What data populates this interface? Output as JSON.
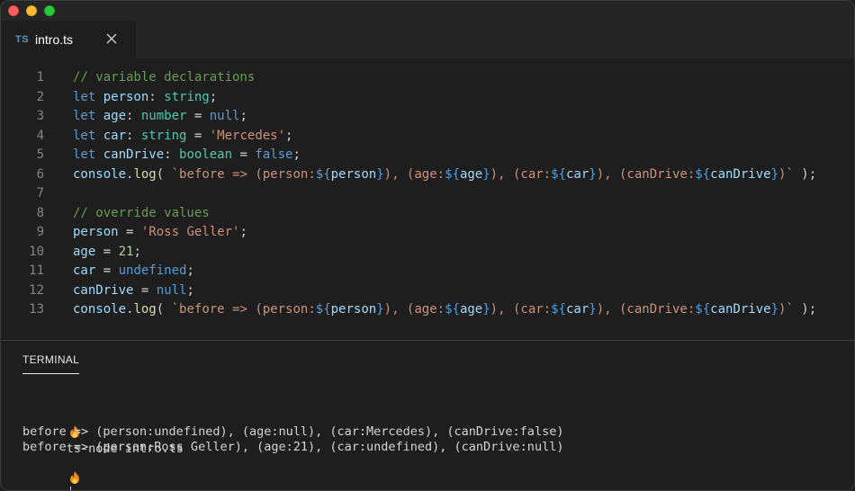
{
  "tab": {
    "lang": "TS",
    "filename": "intro.ts"
  },
  "editor": {
    "lines": [
      {
        "num": "1",
        "tokens": [
          {
            "t": "// variable declarations",
            "c": "comment"
          }
        ]
      },
      {
        "num": "2",
        "tokens": [
          {
            "t": "let ",
            "c": "keyword"
          },
          {
            "t": "person",
            "c": "variable"
          },
          {
            "t": ": ",
            "c": "punct"
          },
          {
            "t": "string",
            "c": "type"
          },
          {
            "t": ";",
            "c": "punct"
          }
        ]
      },
      {
        "num": "3",
        "tokens": [
          {
            "t": "let ",
            "c": "keyword"
          },
          {
            "t": "age",
            "c": "variable"
          },
          {
            "t": ": ",
            "c": "punct"
          },
          {
            "t": "number",
            "c": "type"
          },
          {
            "t": " = ",
            "c": "punct"
          },
          {
            "t": "null",
            "c": "keyword"
          },
          {
            "t": ";",
            "c": "punct"
          }
        ]
      },
      {
        "num": "4",
        "tokens": [
          {
            "t": "let ",
            "c": "keyword"
          },
          {
            "t": "car",
            "c": "variable"
          },
          {
            "t": ": ",
            "c": "punct"
          },
          {
            "t": "string",
            "c": "type"
          },
          {
            "t": " = ",
            "c": "punct"
          },
          {
            "t": "'Mercedes'",
            "c": "string"
          },
          {
            "t": ";",
            "c": "punct"
          }
        ]
      },
      {
        "num": "5",
        "tokens": [
          {
            "t": "let ",
            "c": "keyword"
          },
          {
            "t": "canDrive",
            "c": "variable"
          },
          {
            "t": ": ",
            "c": "punct"
          },
          {
            "t": "boolean",
            "c": "type"
          },
          {
            "t": " = ",
            "c": "punct"
          },
          {
            "t": "false",
            "c": "keyword"
          },
          {
            "t": ";",
            "c": "punct"
          }
        ]
      },
      {
        "num": "6",
        "tokens": [
          {
            "t": "console",
            "c": "variable"
          },
          {
            "t": ".",
            "c": "punct"
          },
          {
            "t": "log",
            "c": "func"
          },
          {
            "t": "( ",
            "c": "punct"
          },
          {
            "t": "`before => (person:",
            "c": "string"
          },
          {
            "t": "${",
            "c": "interp"
          },
          {
            "t": "person",
            "c": "variable"
          },
          {
            "t": "}",
            "c": "interp"
          },
          {
            "t": "), (age:",
            "c": "string"
          },
          {
            "t": "${",
            "c": "interp"
          },
          {
            "t": "age",
            "c": "variable"
          },
          {
            "t": "}",
            "c": "interp"
          },
          {
            "t": "), (car:",
            "c": "string"
          },
          {
            "t": "${",
            "c": "interp"
          },
          {
            "t": "car",
            "c": "variable"
          },
          {
            "t": "}",
            "c": "interp"
          },
          {
            "t": "), (canDrive:",
            "c": "string"
          },
          {
            "t": "${",
            "c": "interp"
          },
          {
            "t": "canDrive",
            "c": "variable"
          },
          {
            "t": "}",
            "c": "interp"
          },
          {
            "t": ")`",
            "c": "string"
          },
          {
            "t": " );",
            "c": "punct"
          }
        ]
      },
      {
        "num": "7",
        "tokens": []
      },
      {
        "num": "8",
        "tokens": [
          {
            "t": "// override values",
            "c": "comment"
          }
        ]
      },
      {
        "num": "9",
        "tokens": [
          {
            "t": "person",
            "c": "variable"
          },
          {
            "t": " = ",
            "c": "punct"
          },
          {
            "t": "'Ross Geller'",
            "c": "string"
          },
          {
            "t": ";",
            "c": "punct"
          }
        ]
      },
      {
        "num": "10",
        "tokens": [
          {
            "t": "age",
            "c": "variable"
          },
          {
            "t": " = ",
            "c": "punct"
          },
          {
            "t": "21",
            "c": "number"
          },
          {
            "t": ";",
            "c": "punct"
          }
        ]
      },
      {
        "num": "11",
        "tokens": [
          {
            "t": "car",
            "c": "variable"
          },
          {
            "t": " = ",
            "c": "punct"
          },
          {
            "t": "undefined",
            "c": "keyword"
          },
          {
            "t": ";",
            "c": "punct"
          }
        ]
      },
      {
        "num": "12",
        "tokens": [
          {
            "t": "canDrive",
            "c": "variable"
          },
          {
            "t": " = ",
            "c": "punct"
          },
          {
            "t": "null",
            "c": "keyword"
          },
          {
            "t": ";",
            "c": "punct"
          }
        ]
      },
      {
        "num": "13",
        "tokens": [
          {
            "t": "console",
            "c": "variable"
          },
          {
            "t": ".",
            "c": "punct"
          },
          {
            "t": "log",
            "c": "func"
          },
          {
            "t": "( ",
            "c": "punct"
          },
          {
            "t": "`before => (person:",
            "c": "string"
          },
          {
            "t": "${",
            "c": "interp"
          },
          {
            "t": "person",
            "c": "variable"
          },
          {
            "t": "}",
            "c": "interp"
          },
          {
            "t": "), (age:",
            "c": "string"
          },
          {
            "t": "${",
            "c": "interp"
          },
          {
            "t": "age",
            "c": "variable"
          },
          {
            "t": "}",
            "c": "interp"
          },
          {
            "t": "), (car:",
            "c": "string"
          },
          {
            "t": "${",
            "c": "interp"
          },
          {
            "t": "car",
            "c": "variable"
          },
          {
            "t": "}",
            "c": "interp"
          },
          {
            "t": "), (canDrive:",
            "c": "string"
          },
          {
            "t": "${",
            "c": "interp"
          },
          {
            "t": "canDrive",
            "c": "variable"
          },
          {
            "t": "}",
            "c": "interp"
          },
          {
            "t": ")`",
            "c": "string"
          },
          {
            "t": " );",
            "c": "punct"
          }
        ]
      }
    ]
  },
  "terminal": {
    "tab_label": "TERMINAL",
    "prompt_icon": "fire-icon",
    "command": "ts-node intro.ts",
    "output": [
      "before => (person:undefined), (age:null), (car:Mercedes), (canDrive:false)",
      "before => (person:Ross Geller), (age:21), (car:undefined), (canDrive:null)"
    ]
  },
  "colors": {
    "comment": "#6a9955",
    "keyword": "#569cd6",
    "variable": "#9cdcfe",
    "type": "#4ec9b0",
    "string": "#ce9178",
    "number": "#b5cea8",
    "func": "#dcdcaa"
  }
}
